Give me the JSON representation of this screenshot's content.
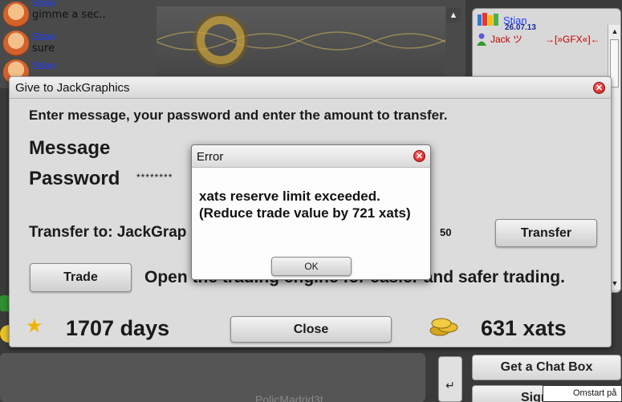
{
  "chat": {
    "messages": [
      {
        "name": "Stian",
        "text": "gimme a sec.."
      },
      {
        "name": "Stian",
        "text": "sure"
      },
      {
        "name": "Stian",
        "text": ""
      }
    ]
  },
  "userlist": {
    "user1": {
      "name": "Stian",
      "date": "26.07.13"
    },
    "user2": {
      "name": "Jack ツ",
      "tag": "→[»GFX«]←"
    }
  },
  "give_dialog": {
    "title": "Give to JackGraphics",
    "instructions": "Enter message, your password and enter the amount to transfer.",
    "message_label": "Message",
    "password_label": "Password",
    "password_value": "********",
    "transfer_to": "Transfer to: JackGrap",
    "amount": "50",
    "transfer_button": "Transfer",
    "trade_button": "Trade",
    "trade_description": "Open the trading engine for easier and safer trading.",
    "days": "1707 days",
    "close_button": "Close",
    "xats": "631 xats"
  },
  "error_dialog": {
    "title": "Error",
    "message": "xats reserve limit exceeded. (Reduce trade value by 721 xats)",
    "ok_button": "OK"
  },
  "bottom": {
    "get_chat_box": "Get a Chat Box",
    "sign_button": "Sign",
    "restart_tooltip": "Omstart på",
    "watermark": "PolicMadrid3t",
    "enter_glyph": "↵"
  },
  "colors": {
    "name_blue": "#1e3cff",
    "name_red": "#c00000",
    "close_red": "#c41414",
    "star_gold": "#f0b400"
  }
}
